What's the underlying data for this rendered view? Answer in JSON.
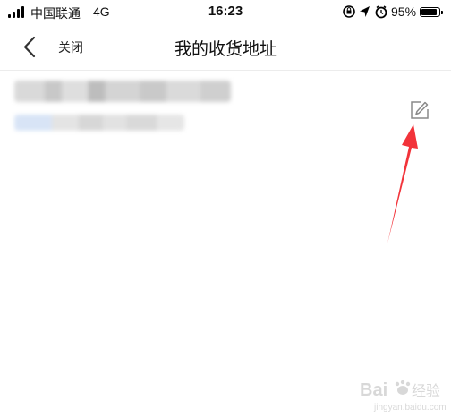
{
  "status_bar": {
    "carrier": "中国联通",
    "network": "4G",
    "time": "16:23",
    "battery": "95%",
    "battery_level": 0.95
  },
  "nav": {
    "close_label": "关闭",
    "title": "我的收货地址"
  },
  "address": {
    "blurred": true
  },
  "icons": {
    "back": "chevron-left-icon",
    "edit": "edit-icon",
    "annotation": "red-arrow"
  },
  "colors": {
    "annotation": "#f2333a"
  }
}
